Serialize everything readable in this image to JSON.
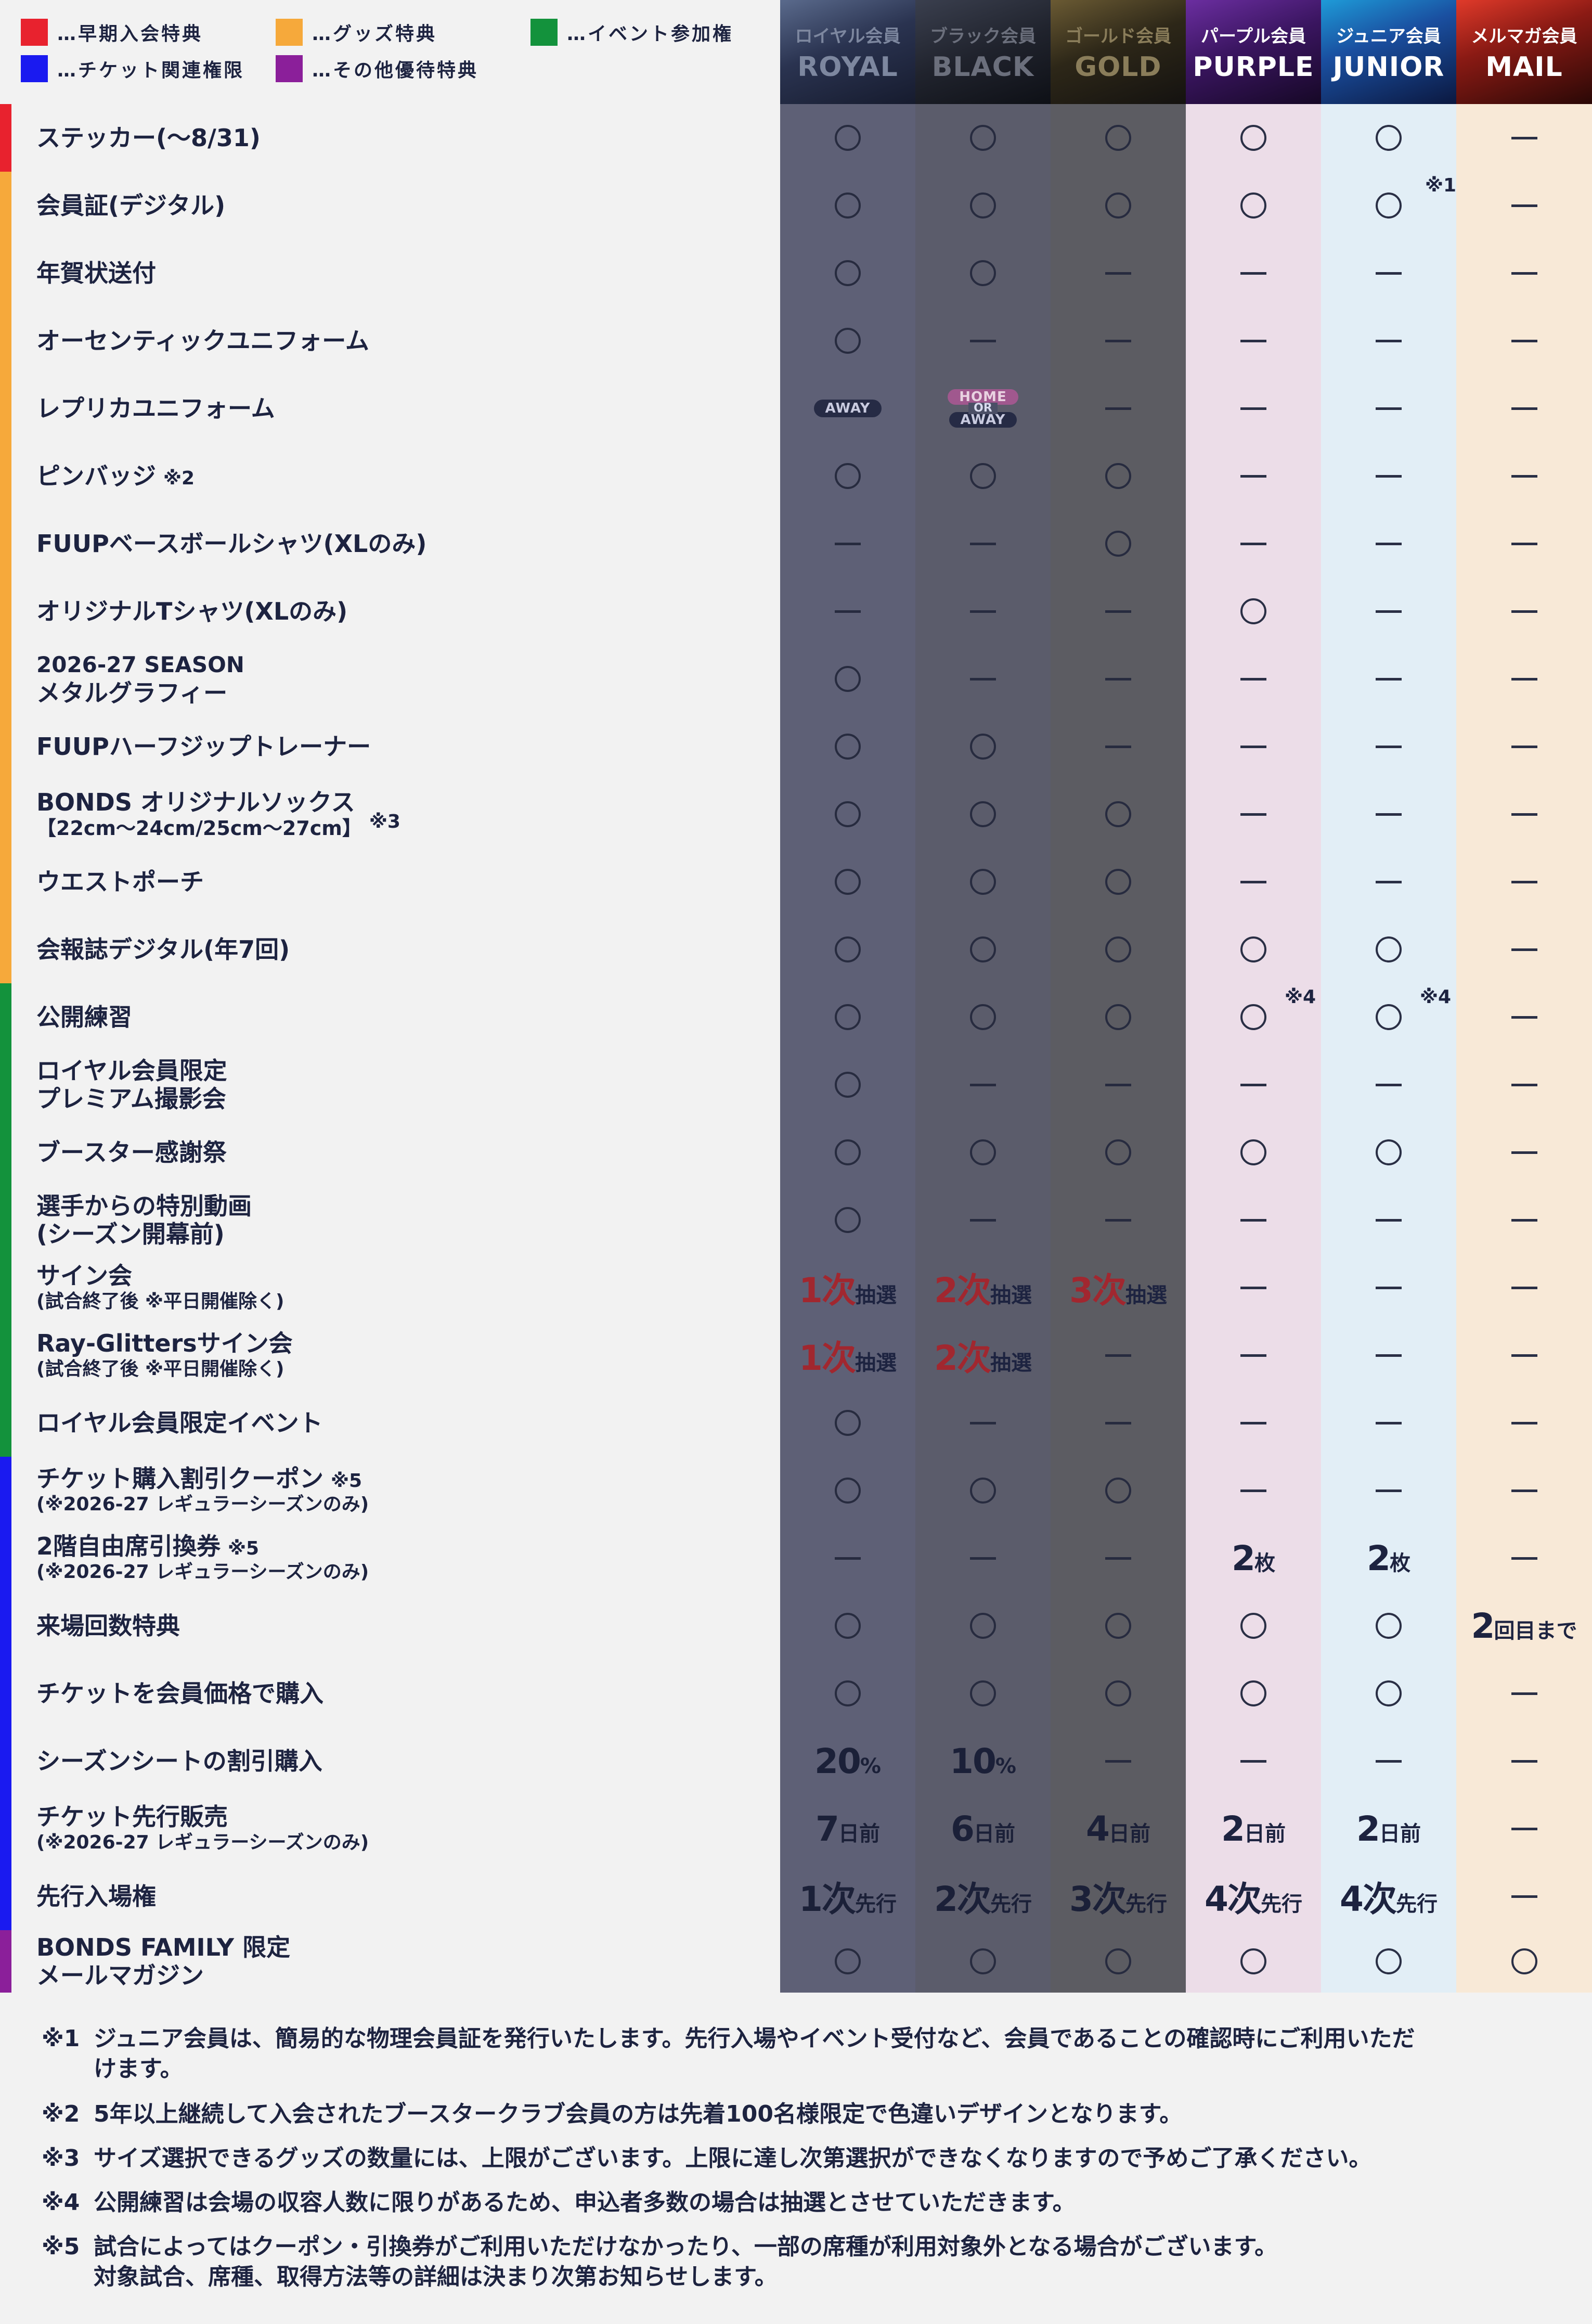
{
  "legend": [
    {
      "label": "…早期入会特典",
      "color": "#e8222e"
    },
    {
      "label": "…グッズ特典",
      "color": "#f6a93b"
    },
    {
      "label": "…イベント参加権",
      "color": "#13923c"
    },
    {
      "label": "…チケット関連権限",
      "color": "#1a1af0"
    },
    {
      "label": "…その他優待特典",
      "color": "#8b1f9a"
    }
  ],
  "columns": [
    {
      "jp": "ロイヤル会員",
      "en": "ROYAL"
    },
    {
      "jp": "ブラック会員",
      "en": "BLACK"
    },
    {
      "jp": "ゴールド会員",
      "en": "GOLD"
    },
    {
      "jp": "パープル会員",
      "en": "PURPLE"
    },
    {
      "jp": "ジュニア会員",
      "en": "JUNIOR"
    },
    {
      "jp": "メルマガ会員",
      "en": "MAIL"
    }
  ],
  "pills": {
    "away": "AWAY",
    "home": "HOME",
    "or": "OR"
  },
  "rows": [
    {
      "label": "ステッカー(〜8/31)"
    },
    {
      "label": "会員証(デジタル)"
    },
    {
      "label": "年賀状送付"
    },
    {
      "label": "オーセンティックユニフォーム"
    },
    {
      "label": "レプリカユニフォーム"
    },
    {
      "label": "ピンバッジ",
      "note": "※2"
    },
    {
      "label": "FUUPベースボールシャツ(XLのみ)"
    },
    {
      "label": "オリジナルTシャツ(XLのみ)"
    },
    {
      "label": "2026-27 SEASON",
      "label2": "メタルグラフィー"
    },
    {
      "label": "FUUPハーフジップトレーナー"
    },
    {
      "label": "BONDS オリジナルソックス",
      "sub": "【22cm〜24cm/25cm〜27cm】",
      "note": "※3"
    },
    {
      "label": "ウエストポーチ"
    },
    {
      "label": "会報誌デジタル(年7回)"
    },
    {
      "label": "公開練習"
    },
    {
      "label": "ロイヤル会員限定",
      "label2": "プレミアム撮影会"
    },
    {
      "label": "ブースター感謝祭"
    },
    {
      "label": "選手からの特別動画",
      "label2": "(シーズン開幕前)"
    },
    {
      "label": "サイン会",
      "sub": "(試合終了後 ※平日開催除く)"
    },
    {
      "label": "Ray-Glittersサイン会",
      "sub": "(試合終了後 ※平日開催除く)"
    },
    {
      "label": "ロイヤル会員限定イベント"
    },
    {
      "label": "チケット購入割引クーポン",
      "note": "※5",
      "sub": "(※2026-27 レギュラーシーズンのみ)"
    },
    {
      "label": "2階自由席引換券",
      "note": "※5",
      "sub": "(※2026-27 レギュラーシーズンのみ)"
    },
    {
      "label": "来場回数特典"
    },
    {
      "label": "チケットを会員価格で購入"
    },
    {
      "label": "シーズンシートの割引購入"
    },
    {
      "label": "チケット先行販売",
      "sub": "(※2026-27 レギュラーシーズンのみ)"
    },
    {
      "label": "先行入場権"
    },
    {
      "label": "BONDS FAMILY 限定",
      "label2": "メールマガジン"
    }
  ],
  "values": {
    "lottery": {
      "n1": "1次",
      "n2": "2次",
      "n3": "3次",
      "unit": "抽選"
    },
    "mail_visit": {
      "n": "2",
      "unit": "回目まで"
    },
    "tickets": {
      "n": "2",
      "unit": "枚"
    },
    "discount": {
      "royal": "20",
      "black": "10",
      "unit": "%"
    },
    "presale": {
      "royal": "7",
      "black": "6",
      "gold": "4",
      "purple": "2",
      "junior": "2",
      "unit": "日前"
    },
    "entry": {
      "royal": "1次",
      "black": "2次",
      "gold": "3次",
      "purple": "4次",
      "junior": "4次",
      "unit": "先行"
    }
  },
  "footnote_marks": {
    "junior_card": "※1",
    "purple_practice": "※4",
    "junior_practice": "※4"
  },
  "footnotes": [
    {
      "mark": "※1",
      "text": "ジュニア会員は、簡易的な物理会員証を発行いたします。先行入場やイベント受付など、会員であることの確認時にご利用いただ",
      "cont": "けます。"
    },
    {
      "mark": "※2",
      "text": "5年以上継続して入会されたブースタークラブ会員の方は先着100名様限定で色違いデザインとなります。"
    },
    {
      "mark": "※3",
      "text": "サイズ選択できるグッズの数量には、上限がございます。上限に達し次第選択ができなくなりますので予めご了承ください。"
    },
    {
      "mark": "※4",
      "text": "公開練習は会場の収容人数に限りがあるため、申込者多数の場合は抽選とさせていただきます。"
    },
    {
      "mark": "※5",
      "text": "試合によってはクーポン・引換券がご利用いただけなかったり、一部の席種が利用対象外となる場合がございます。",
      "cont": "対象試合、席種、取得方法等の詳細は決まり次第お知らせします。"
    }
  ]
}
